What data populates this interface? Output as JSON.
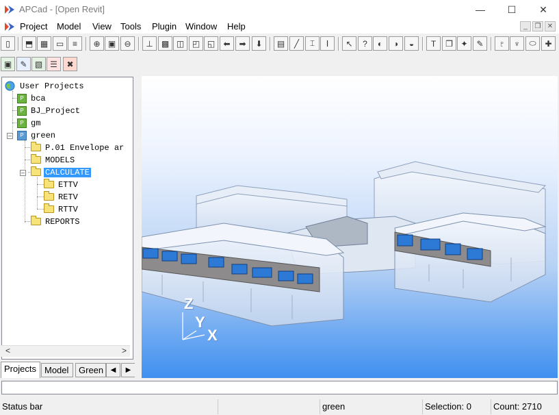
{
  "window": {
    "title": "APCad - [Open Revit]",
    "controls": {
      "minimize": "—",
      "maximize": "☐",
      "close": "✕"
    }
  },
  "menu": {
    "items": [
      "Project",
      "Model",
      "View",
      "Tools",
      "Plugin",
      "Window",
      "Help"
    ],
    "mdi_controls": {
      "minimize": "_",
      "restore": "❐",
      "close": "✕"
    }
  },
  "toolbar1": {
    "buttons": [
      {
        "icon": "new-doc-icon",
        "glyph": "▯"
      },
      {
        "icon": "import-icon",
        "glyph": "⬒"
      },
      {
        "icon": "table-icon",
        "glyph": "▦"
      },
      {
        "icon": "window-icon",
        "glyph": "▭"
      },
      {
        "icon": "list-icon",
        "glyph": "≡"
      },
      {
        "icon": "zoom-in-icon",
        "glyph": "⊕"
      },
      {
        "icon": "save-icon",
        "glyph": "▣"
      },
      {
        "icon": "zoom-out-icon",
        "glyph": "⊖"
      },
      {
        "icon": "axis-icon",
        "glyph": "⊥"
      },
      {
        "icon": "cube-icon",
        "glyph": "▩"
      },
      {
        "icon": "view-front-icon",
        "glyph": "◫"
      },
      {
        "icon": "view-back-icon",
        "glyph": "◰"
      },
      {
        "icon": "view-side-icon",
        "glyph": "◱"
      },
      {
        "icon": "view-left-icon",
        "glyph": "⬅"
      },
      {
        "icon": "view-right-icon",
        "glyph": "➡"
      },
      {
        "icon": "view-down-icon",
        "glyph": "⬇"
      },
      {
        "icon": "properties-icon",
        "glyph": "▤"
      },
      {
        "icon": "line-icon",
        "glyph": "╱"
      },
      {
        "icon": "beam-icon",
        "glyph": "⌶"
      },
      {
        "icon": "column-icon",
        "glyph": "Ⅰ"
      },
      {
        "icon": "select-icon",
        "glyph": "↖"
      },
      {
        "icon": "query-icon",
        "glyph": "?"
      },
      {
        "icon": "hide-icon",
        "glyph": "◐"
      },
      {
        "icon": "show-icon",
        "glyph": "◑"
      },
      {
        "icon": "filter-icon",
        "glyph": "◒"
      },
      {
        "icon": "text-icon",
        "glyph": "T"
      },
      {
        "icon": "copy-icon",
        "glyph": "❐"
      },
      {
        "icon": "compass-icon",
        "glyph": "✦"
      },
      {
        "icon": "edit-icon",
        "glyph": "✎"
      },
      {
        "icon": "hierarchy-icon",
        "glyph": "♇"
      },
      {
        "icon": "hierarchy-add-icon",
        "glyph": "♆"
      },
      {
        "icon": "share-icon",
        "glyph": "⬭"
      },
      {
        "icon": "hierarchy-plus-icon",
        "glyph": "✚"
      }
    ]
  },
  "toolbar2": {
    "buttons": [
      {
        "icon": "project-new-icon",
        "glyph": "▣"
      },
      {
        "icon": "project-edit-icon",
        "glyph": "✎"
      },
      {
        "icon": "project-open-icon",
        "glyph": "▧"
      },
      {
        "icon": "lock-icon",
        "glyph": "☰"
      },
      {
        "icon": "delete-icon",
        "glyph": "✖"
      }
    ]
  },
  "tree": {
    "root": "User Projects",
    "projects": [
      "bca",
      "BJ_Project",
      "gm",
      "green"
    ],
    "green_children": [
      "P.01 Envelope ar",
      "MODELS",
      "CALCULATE",
      "REPORTS"
    ],
    "calculate_children": [
      "ETTV",
      "RETV",
      "RTTV"
    ],
    "selected": "CALCULATE",
    "scroll": {
      "left": "<",
      "right": ">"
    }
  },
  "panel_tabs": {
    "tabs": [
      "Projects",
      "Model",
      "Green l"
    ],
    "active": "Projects",
    "nav": {
      "prev": "◀",
      "next": "▶"
    }
  },
  "viewport": {
    "axes": {
      "z": "Z",
      "y": "Y",
      "x": "X"
    }
  },
  "command_input": {
    "value": ""
  },
  "statusbar": {
    "message": "Status bar",
    "project": "green",
    "selection": "Selection: 0",
    "count": "Count: 2710"
  }
}
